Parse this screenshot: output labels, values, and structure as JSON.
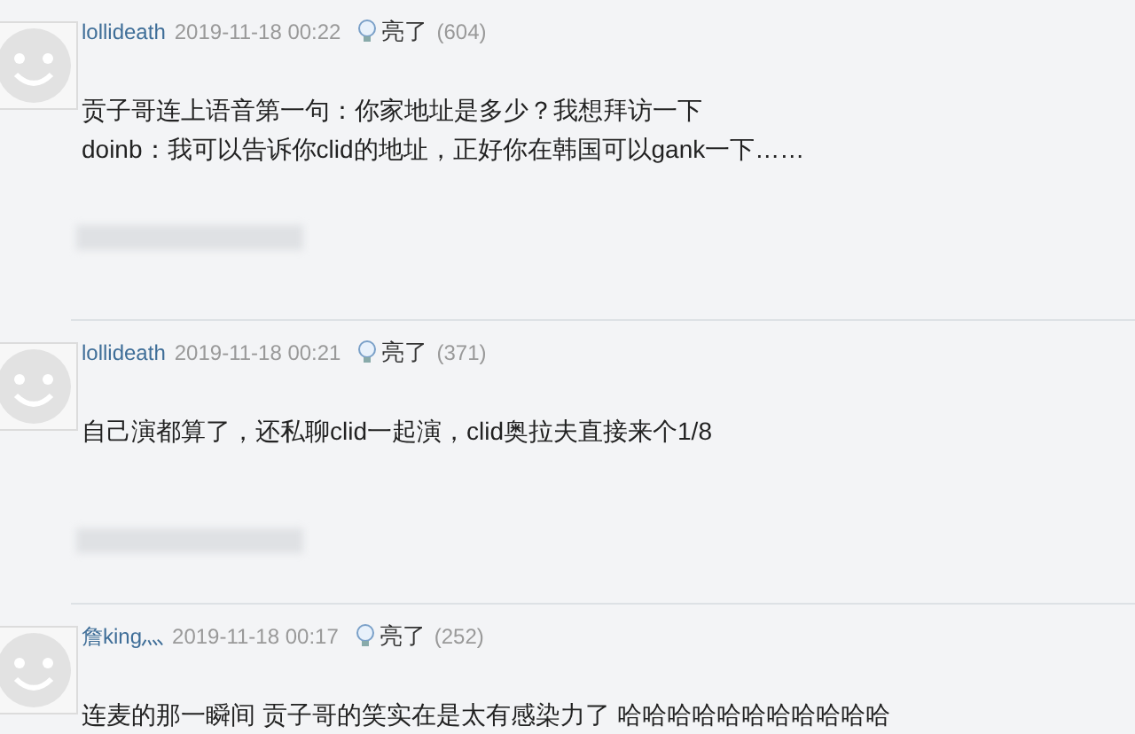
{
  "comments": [
    {
      "user": "lollideath",
      "time": "2019-11-18 00:22",
      "like_label": "亮了",
      "like_count": "(604)",
      "lines": [
        "贡子哥连上语音第一句：你家地址是多少？我想拜访一下",
        "doinb：我可以告诉你clid的地址，正好你在韩国可以gank一下……"
      ]
    },
    {
      "user": "lollideath",
      "time": "2019-11-18 00:21",
      "like_label": "亮了",
      "like_count": "(371)",
      "lines": [
        "自己演都算了，还私聊clid一起演，clid奥拉夫直接来个1/8"
      ]
    },
    {
      "user": "詹king灬",
      "time": "2019-11-18 00:17",
      "like_label": "亮了",
      "like_count": "(252)",
      "lines": [
        "连麦的那一瞬间 贡子哥的笑实在是太有感染力了 哈哈哈哈哈哈哈哈哈哈哈"
      ]
    }
  ]
}
